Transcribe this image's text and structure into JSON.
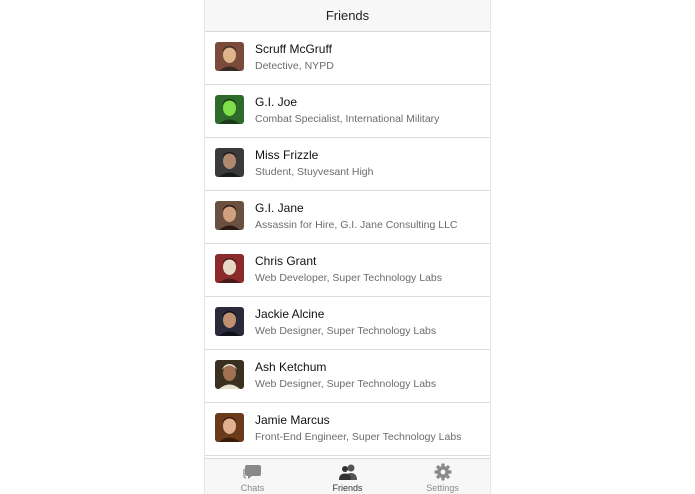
{
  "navbar": {
    "title": "Friends"
  },
  "friends": [
    {
      "name": "Scruff McGruff",
      "subtitle": "Detective, NYPD",
      "avatar_colors": [
        "#7a4a3a",
        "#e0b48a",
        "#3a2a22"
      ]
    },
    {
      "name": "G.I. Joe",
      "subtitle": "Combat Specialist, International Military",
      "avatar_colors": [
        "#2e6b2a",
        "#7fe04a",
        "#1a3a18"
      ]
    },
    {
      "name": "Miss Frizzle",
      "subtitle": "Student, Stuyvesant High",
      "avatar_colors": [
        "#3a3a3a",
        "#b08870",
        "#1a1a1a"
      ]
    },
    {
      "name": "G.I. Jane",
      "subtitle": "Assassin for Hire, G.I. Jane Consulting LLC",
      "avatar_colors": [
        "#6a5040",
        "#d0a080",
        "#2a1a12"
      ]
    },
    {
      "name": "Chris Grant",
      "subtitle": "Web Developer, Super Technology Labs",
      "avatar_colors": [
        "#8a2a2a",
        "#e8d8c8",
        "#4a1a1a"
      ]
    },
    {
      "name": "Jackie Alcine",
      "subtitle": "Web Designer, Super Technology Labs",
      "avatar_colors": [
        "#2a2a3a",
        "#c09070",
        "#101018"
      ]
    },
    {
      "name": "Ash Ketchum",
      "subtitle": "Web Designer, Super Technology Labs",
      "avatar_colors": [
        "#3a3020",
        "#a07050",
        "#e8e0d0"
      ]
    },
    {
      "name": "Jamie Marcus",
      "subtitle": "Front-End Engineer, Super Technology Labs",
      "avatar_colors": [
        "#6a3a1a",
        "#e0b090",
        "#3a1a0a"
      ]
    }
  ],
  "tabbar": {
    "tabs": [
      {
        "label": "Chats",
        "icon": "chat-bubbles-icon",
        "active": false
      },
      {
        "label": "Friends",
        "icon": "people-icon",
        "active": true
      },
      {
        "label": "Settings",
        "icon": "gear-icon",
        "active": false
      }
    ],
    "icon_color": "#8a8a8a",
    "active_icon_color": "#333333"
  }
}
